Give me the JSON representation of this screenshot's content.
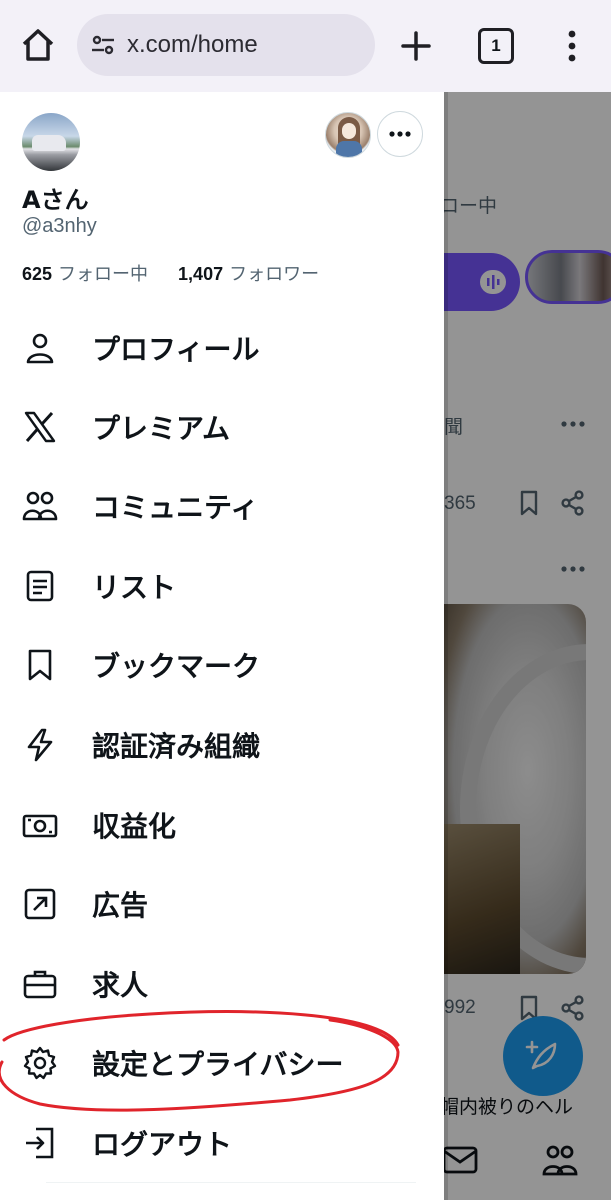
{
  "browser": {
    "url": "x.com/home",
    "tab_count": "1",
    "icons": [
      "home-icon",
      "site-settings-icon",
      "new-tab-icon",
      "tab-switcher-icon",
      "overflow-menu-icon"
    ]
  },
  "feed": {
    "following_fragment": "ロー中",
    "post1_fragment": "聞",
    "post1_count": "365",
    "post2_count": "992",
    "post2_text_fragment": "帽内被りのヘル"
  },
  "drawer": {
    "display_name": "Aさん",
    "handle": "@a3nhy",
    "following_count": "625",
    "following_label": "フォロー中",
    "followers_count": "1,407",
    "followers_label": "フォロワー",
    "items": [
      {
        "label": "プロフィール",
        "icon": "person-icon"
      },
      {
        "label": "プレミアム",
        "icon": "x-logo-icon"
      },
      {
        "label": "コミュニティ",
        "icon": "communities-icon"
      },
      {
        "label": "リスト",
        "icon": "lists-icon"
      },
      {
        "label": "ブックマーク",
        "icon": "bookmark-icon"
      },
      {
        "label": "認証済み組織",
        "icon": "lightning-icon"
      },
      {
        "label": "収益化",
        "icon": "money-icon"
      },
      {
        "label": "広告",
        "icon": "ads-arrow-icon"
      },
      {
        "label": "求人",
        "icon": "briefcase-icon"
      },
      {
        "label": "設定とプライバシー",
        "icon": "gear-icon"
      },
      {
        "label": "ログアウト",
        "icon": "logout-icon"
      }
    ]
  },
  "colors": {
    "accent": "#1d9bf0",
    "spaces": "#7856ff",
    "annotation": "#e0242b",
    "text": "#0f1419",
    "muted": "#536471"
  }
}
